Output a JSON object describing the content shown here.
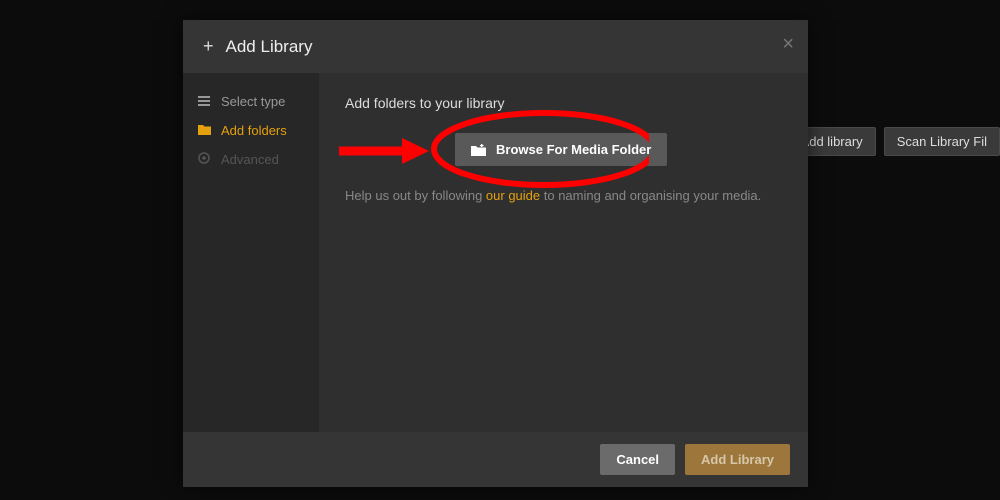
{
  "background": {
    "buttons": {
      "add_library": "Add library",
      "scan": "Scan Library Fil"
    }
  },
  "modal": {
    "title": "Add Library",
    "sidebar": {
      "items": [
        {
          "label": "Select type"
        },
        {
          "label": "Add folders"
        },
        {
          "label": "Advanced"
        }
      ]
    },
    "main": {
      "title": "Add folders to your library",
      "browse_label": "Browse For Media Folder",
      "help_prefix": "Help us out by following ",
      "help_link": "our guide",
      "help_suffix": " to naming and organising your media."
    },
    "footer": {
      "cancel": "Cancel",
      "confirm": "Add Library"
    }
  },
  "colors": {
    "accent": "#e5a00d",
    "annotation": "#ff0000"
  }
}
